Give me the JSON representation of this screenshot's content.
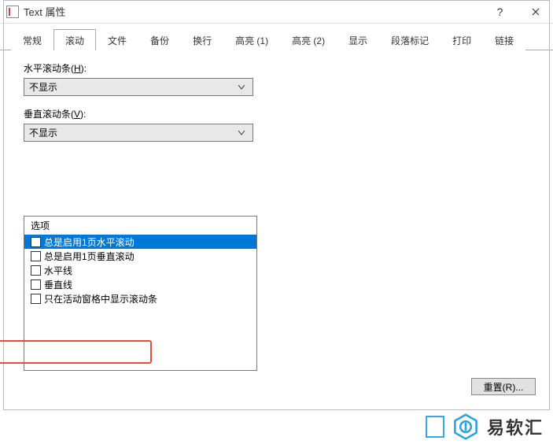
{
  "window": {
    "title": "Text 属性",
    "help": "?",
    "close": "✕"
  },
  "tabs": [
    {
      "label": "常规"
    },
    {
      "label": "滚动"
    },
    {
      "label": "文件"
    },
    {
      "label": "备份"
    },
    {
      "label": "换行"
    },
    {
      "label": "高亮 (1)"
    },
    {
      "label": "高亮 (2)"
    },
    {
      "label": "显示"
    },
    {
      "label": "段落标记"
    },
    {
      "label": "打印"
    },
    {
      "label": "链接"
    }
  ],
  "active_tab_index": 1,
  "horiz": {
    "label_pre": "水平滚动条(",
    "label_u": "H",
    "label_post": "):",
    "value": "不显示"
  },
  "vert": {
    "label_pre": "垂直滚动条(",
    "label_u": "V",
    "label_post": "):",
    "value": "不显示"
  },
  "options": {
    "header": "选项",
    "items": [
      {
        "label": "总是启用1页水平滚动",
        "selected": true
      },
      {
        "label": "总是启用1页垂直滚动",
        "selected": false
      },
      {
        "label": "水平线",
        "selected": false
      },
      {
        "label": "垂直线",
        "selected": false
      },
      {
        "label": "只在活动窗格中显示滚动条",
        "selected": false
      }
    ]
  },
  "reset_button": "重置(R)...",
  "watermark_text": "易软汇"
}
